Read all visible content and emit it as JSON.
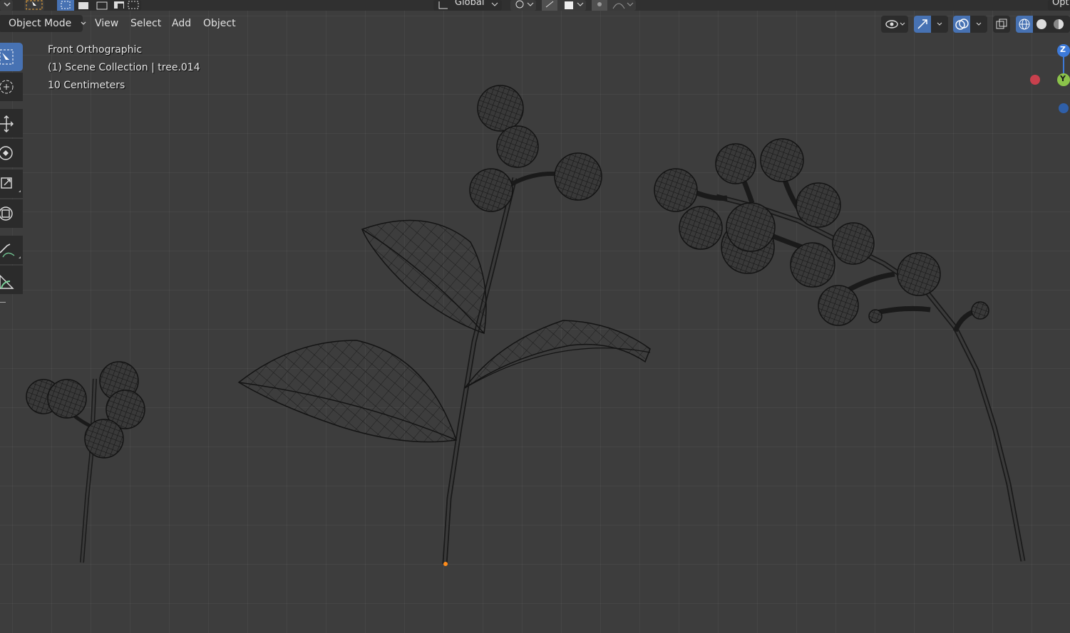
{
  "top_toolbar": {
    "orientation_label": "Global",
    "options_label": "Opt"
  },
  "header": {
    "mode_label": "Object Mode",
    "menus": [
      "View",
      "Select",
      "Add",
      "Object"
    ]
  },
  "viewport_info": {
    "view_name": "Front Orthographic",
    "collection": "(1) Scene Collection | tree.014",
    "scale": "10 Centimeters"
  },
  "gizmo": {
    "z_label": "Z",
    "y_label": "Y",
    "colors": {
      "x": "#c8404d",
      "y": "#8bc34a",
      "z": "#3d7ad9",
      "neg": "#2f5fa8"
    }
  },
  "toolbar_tools": [
    {
      "icon": "select-box-icon",
      "active": true
    },
    {
      "icon": "cursor-icon",
      "active": false
    },
    {
      "icon": "move-icon",
      "active": false
    },
    {
      "icon": "rotate-icon",
      "active": false
    },
    {
      "icon": "scale-icon",
      "active": false
    },
    {
      "icon": "transform-icon",
      "active": false
    },
    {
      "icon": "annotate-icon",
      "active": false
    },
    {
      "icon": "measure-icon",
      "active": false
    }
  ],
  "colors": {
    "accent": "#4772b3",
    "background": "#3d3d3d",
    "wire": "#151515",
    "origin": "#ff8c1a"
  }
}
